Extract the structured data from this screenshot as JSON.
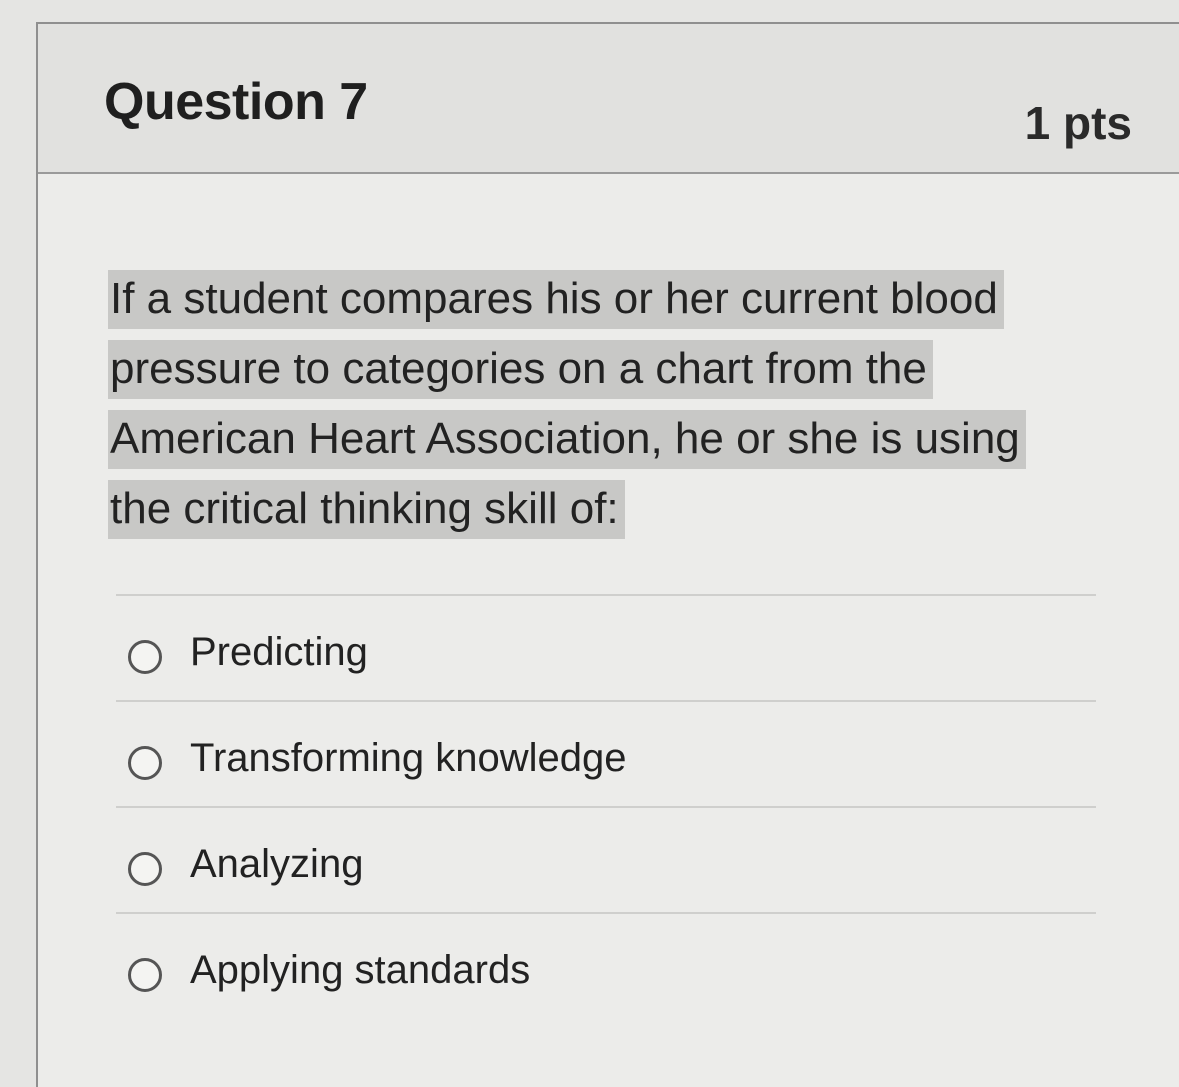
{
  "question": {
    "title": "Question 7",
    "points": "1 pts",
    "text_lines": [
      "If a student compares his or her current blood",
      "pressure to categories on a chart from the",
      "American Heart Association, he or she is using",
      "the critical thinking skill of:"
    ]
  },
  "answers": [
    {
      "label": "Predicting"
    },
    {
      "label": "Transforming knowledge"
    },
    {
      "label": "Analyzing"
    },
    {
      "label": "Applying standards"
    }
  ]
}
